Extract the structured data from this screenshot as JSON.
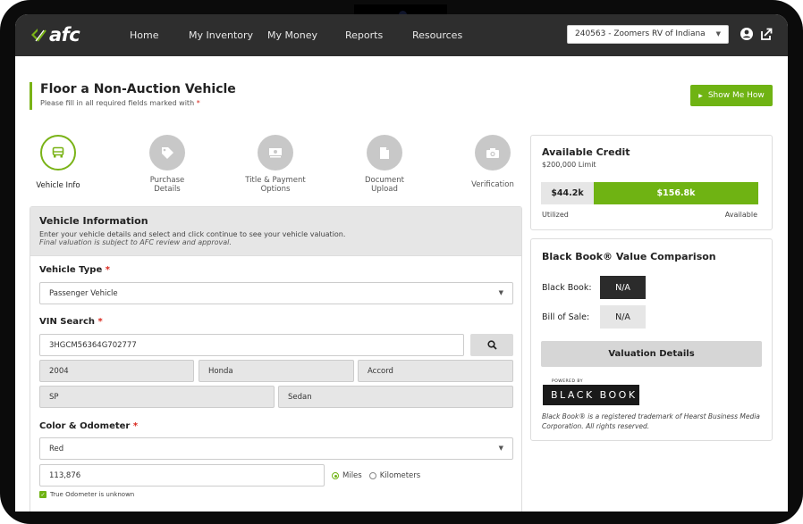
{
  "brand": {
    "logo_text": "afc",
    "accent": "#6fb313",
    "header_bg": "#2e2e2e"
  },
  "nav": {
    "items": [
      "Home",
      "My Inventory",
      "My Money",
      "Reports",
      "Resources"
    ]
  },
  "dealer": {
    "selected": "240563 - Zoomers RV of Indiana"
  },
  "header_icons": [
    "user-icon",
    "logout-icon"
  ],
  "page": {
    "title": "Floor a Non-Auction Vehicle",
    "subtitle": "Please fill in all required fields marked with",
    "required_mark": "*",
    "show_me_how": "Show Me How"
  },
  "steps": [
    {
      "label": "Vehicle Info",
      "icon": "car-icon",
      "active": true
    },
    {
      "label": "Purchase\nDetails",
      "icon": "tag-icon",
      "active": false
    },
    {
      "label": "Title & Payment\nOptions",
      "icon": "money-icon",
      "active": false
    },
    {
      "label": "Document\nUpload",
      "icon": "document-icon",
      "active": false
    },
    {
      "label": "Verification",
      "icon": "camera-icon",
      "active": false
    }
  ],
  "form": {
    "heading": "Vehicle Information",
    "desc": "Enter your vehicle details and select and click continue to see your vehicle valuation.",
    "note": "Final valuation is subject to AFC review and approval.",
    "vehicle_type_label": "Vehicle Type",
    "vehicle_type_value": "Passenger Vehicle",
    "vin_label": "VIN Search",
    "vin_value": "3HGCM56364G702777",
    "year": "2004",
    "make": "Honda",
    "model": "Accord",
    "trim": "SP",
    "body": "Sedan",
    "color_label": "Color & Odometer",
    "color_value": "Red",
    "odometer_value": "113,876",
    "units": [
      "Miles",
      "Kilometers"
    ],
    "units_selected": "Miles",
    "odometer_unknown_label": "True Odometer is unknown",
    "odometer_unknown_checked": true
  },
  "credit": {
    "title": "Available Credit",
    "limit": "$200,000 Limit",
    "utilized_value": "$44.2k",
    "available_value": "$156.8k",
    "utilized_label": "Utilized",
    "available_label": "Available",
    "utilized_fraction": 0.221
  },
  "blackbook": {
    "title": "Black Book® Value Comparison",
    "bb_label": "Black Book:",
    "bb_value": "N/A",
    "bos_label": "Bill of Sale:",
    "bos_value": "N/A",
    "valuation_btn": "Valuation Details",
    "powered_by": "POWERED BY",
    "logo_text": "BLACK BOOK",
    "note": "Black Book® is a registered trademark of Hearst Business Media Corporation. All rights reserved."
  }
}
